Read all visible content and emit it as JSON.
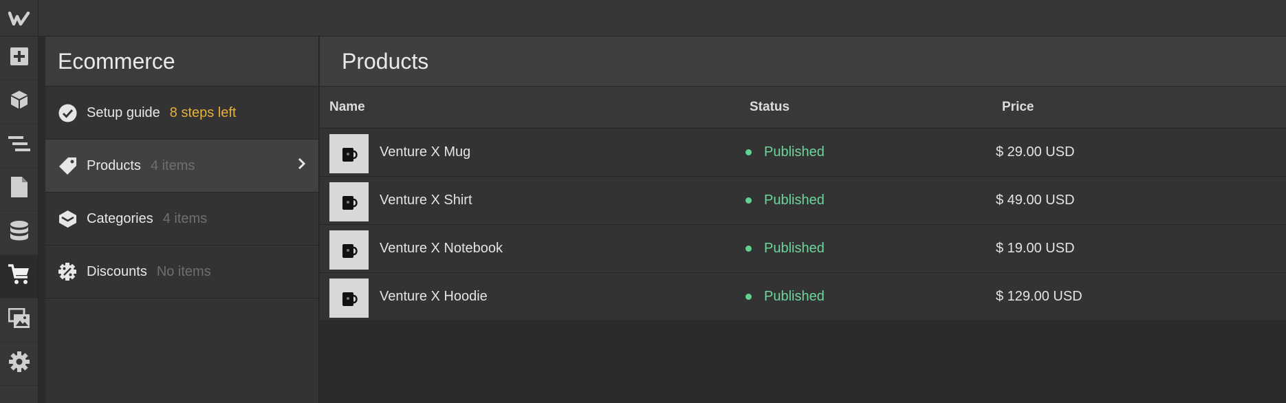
{
  "colors": {
    "accent_warning": "#e6b13a",
    "status_published": "#6cd69b",
    "background": "#2b2b2b"
  },
  "app": {
    "logo_icon": "webflow-logo-icon"
  },
  "toolbar": {
    "tools": [
      {
        "icon": "add-icon"
      },
      {
        "icon": "box-icon"
      },
      {
        "icon": "navigator-icon"
      },
      {
        "icon": "pages-icon"
      },
      {
        "icon": "cms-database-icon"
      },
      {
        "icon": "ecommerce-cart-icon",
        "active": true
      },
      {
        "icon": "assets-images-icon"
      },
      {
        "icon": "settings-gear-icon"
      }
    ]
  },
  "ecommerce_panel": {
    "title": "Ecommerce",
    "items": [
      {
        "label": "Setup guide",
        "sub": "8 steps left",
        "icon": "check-circle-icon"
      },
      {
        "label": "Products",
        "sub": "4 items",
        "icon": "tag-icon",
        "selected": true
      },
      {
        "label": "Categories",
        "sub": "4 items",
        "icon": "layers-icon"
      },
      {
        "label": "Discounts",
        "sub": "No items",
        "icon": "discount-badge-icon"
      }
    ]
  },
  "products": {
    "title": "Products",
    "columns": {
      "name": "Name",
      "status": "Status",
      "price": "Price"
    },
    "rows": [
      {
        "name": "Venture X Mug",
        "status": "Published",
        "price": "$ 29.00 USD"
      },
      {
        "name": "Venture X Shirt",
        "status": "Published",
        "price": "$ 49.00 USD"
      },
      {
        "name": "Venture X Notebook",
        "status": "Published",
        "price": "$ 19.00 USD"
      },
      {
        "name": "Venture X Hoodie",
        "status": "Published",
        "price": "$ 129.00 USD"
      }
    ]
  }
}
